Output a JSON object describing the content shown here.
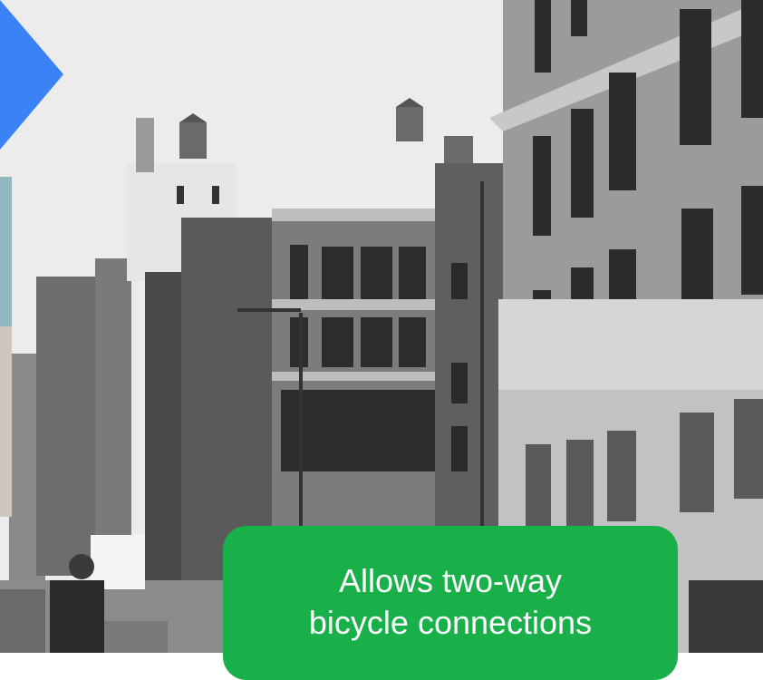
{
  "callout": {
    "line1": "Allows two-way",
    "line2": "bicycle connections"
  },
  "colors": {
    "arrow_blue": "#3b82f6",
    "callout_green": "#19b04a",
    "strip_teal": "#8fb8c0",
    "strip_tan": "#cdc7bd"
  }
}
